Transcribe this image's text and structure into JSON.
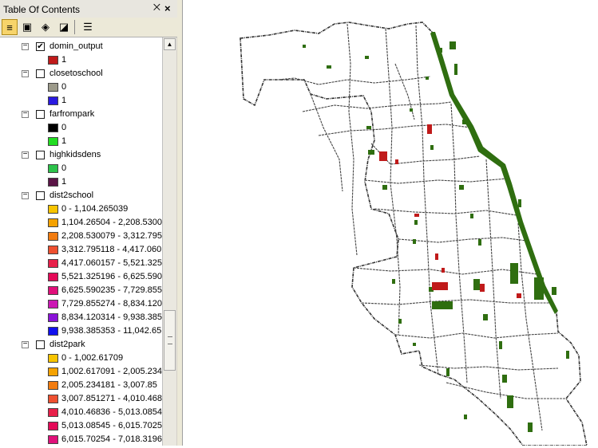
{
  "toc": {
    "title": "Table Of Contents",
    "pin_glyph": "⨉",
    "close_glyph": "×"
  },
  "toolbar": [
    {
      "name": "list-by-drawing-order-button",
      "glyph": "≡",
      "active": true
    },
    {
      "name": "list-by-source-button",
      "glyph": "▣",
      "active": false
    },
    {
      "name": "list-by-visibility-button",
      "glyph": "◈",
      "active": false
    },
    {
      "name": "list-by-selection-button",
      "glyph": "◪",
      "active": false
    },
    {
      "name": "options-button",
      "glyph": "☰",
      "active": false
    }
  ],
  "layers": [
    {
      "name": "domin_output",
      "checked": true,
      "classes": [
        {
          "label": "1",
          "color": "#c01a1a"
        }
      ]
    },
    {
      "name": "closetoschool",
      "checked": false,
      "classes": [
        {
          "label": "0",
          "color": "#9c9a8a"
        },
        {
          "label": "1",
          "color": "#2a1ae0"
        }
      ]
    },
    {
      "name": "farfrompark",
      "checked": false,
      "classes": [
        {
          "label": "0",
          "color": "#000000"
        },
        {
          "label": "1",
          "color": "#22dd22"
        }
      ]
    },
    {
      "name": "highkidsdens",
      "checked": false,
      "classes": [
        {
          "label": "0",
          "color": "#2cc24a"
        },
        {
          "label": "1",
          "color": "#5a1446"
        }
      ]
    },
    {
      "name": "dist2school",
      "checked": false,
      "classes": [
        {
          "label": "0 - 1,104.265039",
          "color": "#f7c400"
        },
        {
          "label": "1,104.26504 - 2,208.5300",
          "color": "#f5a200"
        },
        {
          "label": "2,208.530079 - 3,312.795",
          "color": "#f27c10"
        },
        {
          "label": "3,312.795118 - 4,417.060",
          "color": "#ee5030"
        },
        {
          "label": "4,417.060157 - 5,521.325",
          "color": "#e8204a"
        },
        {
          "label": "5,521.325196 - 6,625.590",
          "color": "#e40a58"
        },
        {
          "label": "6,625.590235 - 7,729.855",
          "color": "#e0107a"
        },
        {
          "label": "7,729.855274 - 8,834.120",
          "color": "#cc18b4"
        },
        {
          "label": "8,834.120314 - 9,938.385",
          "color": "#8a12d8"
        },
        {
          "label": "9,938.385353 - 11,042.65",
          "color": "#1010ee"
        }
      ]
    },
    {
      "name": "dist2park",
      "checked": false,
      "classes": [
        {
          "label": "0 - 1,002.61709",
          "color": "#f7c400"
        },
        {
          "label": "1,002.617091 - 2,005.234",
          "color": "#f5a200"
        },
        {
          "label": "2,005.234181 - 3,007.85",
          "color": "#f27c10"
        },
        {
          "label": "3,007.851271 - 4,010.468",
          "color": "#ee5030"
        },
        {
          "label": "4,010.46836 - 5,013.0854",
          "color": "#e8204a"
        },
        {
          "label": "5,013.08545 - 6,015.7025",
          "color": "#e40a58"
        },
        {
          "label": "6,015.70254 - 7,018.3196",
          "color": "#e0107a"
        }
      ]
    }
  ]
}
